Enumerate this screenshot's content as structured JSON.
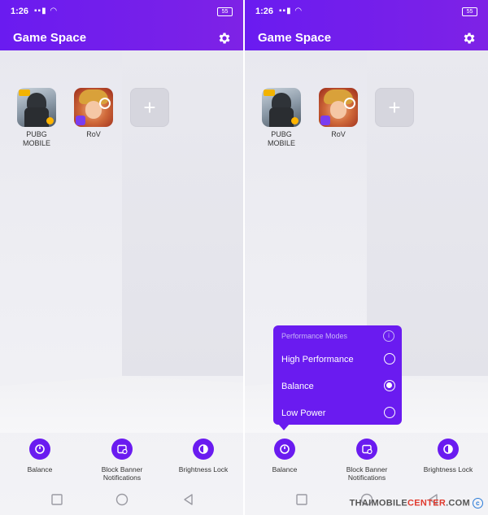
{
  "colors": {
    "accent": "#6a1bf0",
    "background": "#ececf1",
    "watermark_accent": "#e03a2e"
  },
  "screens": [
    {
      "status": {
        "time": "1:26",
        "battery": "55"
      },
      "header": {
        "title": "Game Space",
        "settings_icon": "gear-icon"
      },
      "apps": [
        {
          "label_line1": "PUBG",
          "label_line2": "MOBILE"
        },
        {
          "label_line1": "RoV",
          "label_line2": ""
        }
      ],
      "add_button": {
        "glyph": "+"
      },
      "toolbar": [
        {
          "label_line1": "Balance",
          "label_line2": "",
          "icon": "speedometer-icon"
        },
        {
          "label_line1": "Block Banner",
          "label_line2": "Notifications",
          "icon": "block-notification-icon"
        },
        {
          "label_line1": "Brightness Lock",
          "label_line2": "",
          "icon": "brightness-icon"
        }
      ]
    },
    {
      "status": {
        "time": "1:26",
        "battery": "55"
      },
      "header": {
        "title": "Game Space",
        "settings_icon": "gear-icon"
      },
      "apps": [
        {
          "label_line1": "PUBG",
          "label_line2": "MOBILE"
        },
        {
          "label_line1": "RoV",
          "label_line2": ""
        }
      ],
      "add_button": {
        "glyph": "+"
      },
      "toolbar": [
        {
          "label_line1": "Balance",
          "label_line2": "",
          "icon": "speedometer-icon"
        },
        {
          "label_line1": "Block Banner",
          "label_line2": "Notifications",
          "icon": "block-notification-icon"
        },
        {
          "label_line1": "Brightness Lock",
          "label_line2": "",
          "icon": "brightness-icon"
        }
      ],
      "performance_popup": {
        "title": "Performance Modes",
        "info_glyph": "i",
        "modes": [
          {
            "label": "High Performance",
            "selected": false
          },
          {
            "label": "Balance",
            "selected": true
          },
          {
            "label": "Low Power",
            "selected": false
          }
        ]
      }
    }
  ],
  "watermark": {
    "part1": "THAIMOBILE",
    "part2": "CENTER",
    "part3": ".COM",
    "symbol": "c"
  }
}
